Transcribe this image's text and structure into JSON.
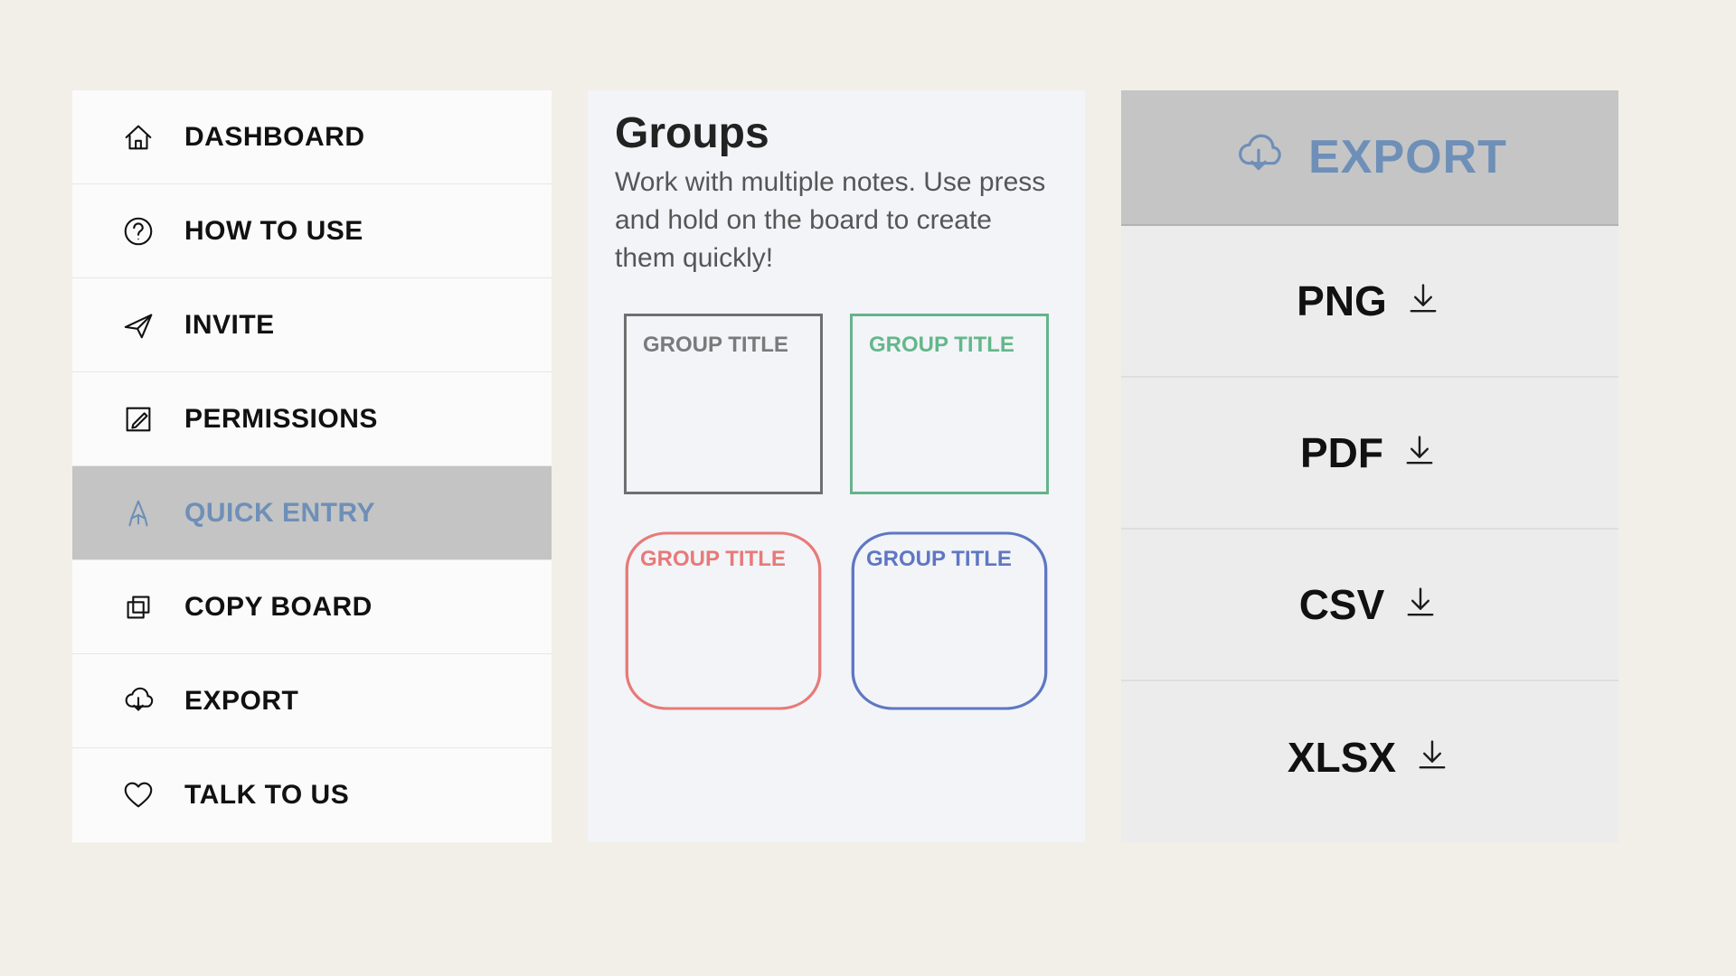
{
  "menu": {
    "items": [
      {
        "label": "DASHBOARD",
        "icon": "home-icon",
        "selected": false
      },
      {
        "label": "HOW TO USE",
        "icon": "help-icon",
        "selected": false
      },
      {
        "label": "INVITE",
        "icon": "paper-plane-icon",
        "selected": false
      },
      {
        "label": "PERMISSIONS",
        "icon": "edit-icon",
        "selected": false
      },
      {
        "label": "QUICK ENTRY",
        "icon": "pencil-icon",
        "selected": true
      },
      {
        "label": "COPY BOARD",
        "icon": "copy-icon",
        "selected": false
      },
      {
        "label": "EXPORT",
        "icon": "cloud-download-icon",
        "selected": false
      },
      {
        "label": "TALK TO US",
        "icon": "heart-icon",
        "selected": false
      }
    ]
  },
  "groups": {
    "title": "Groups",
    "description": "Work with multiple notes. Use press and hold on the board to create them quickly!",
    "tile_label": "GROUP TITLE",
    "tiles": [
      {
        "color": "grey",
        "shape": "square"
      },
      {
        "color": "green",
        "shape": "square"
      },
      {
        "color": "red",
        "shape": "rounded"
      },
      {
        "color": "blue",
        "shape": "rounded"
      }
    ]
  },
  "export": {
    "title": "EXPORT",
    "icon": "cloud-download-icon",
    "formats": [
      "PNG",
      "PDF",
      "CSV",
      "XLSX"
    ]
  },
  "colors": {
    "accent": "#6e8fb7",
    "grey": "#6f6f6f",
    "green": "#66b38a",
    "red": "#e77a78",
    "blue": "#5f77c2"
  }
}
